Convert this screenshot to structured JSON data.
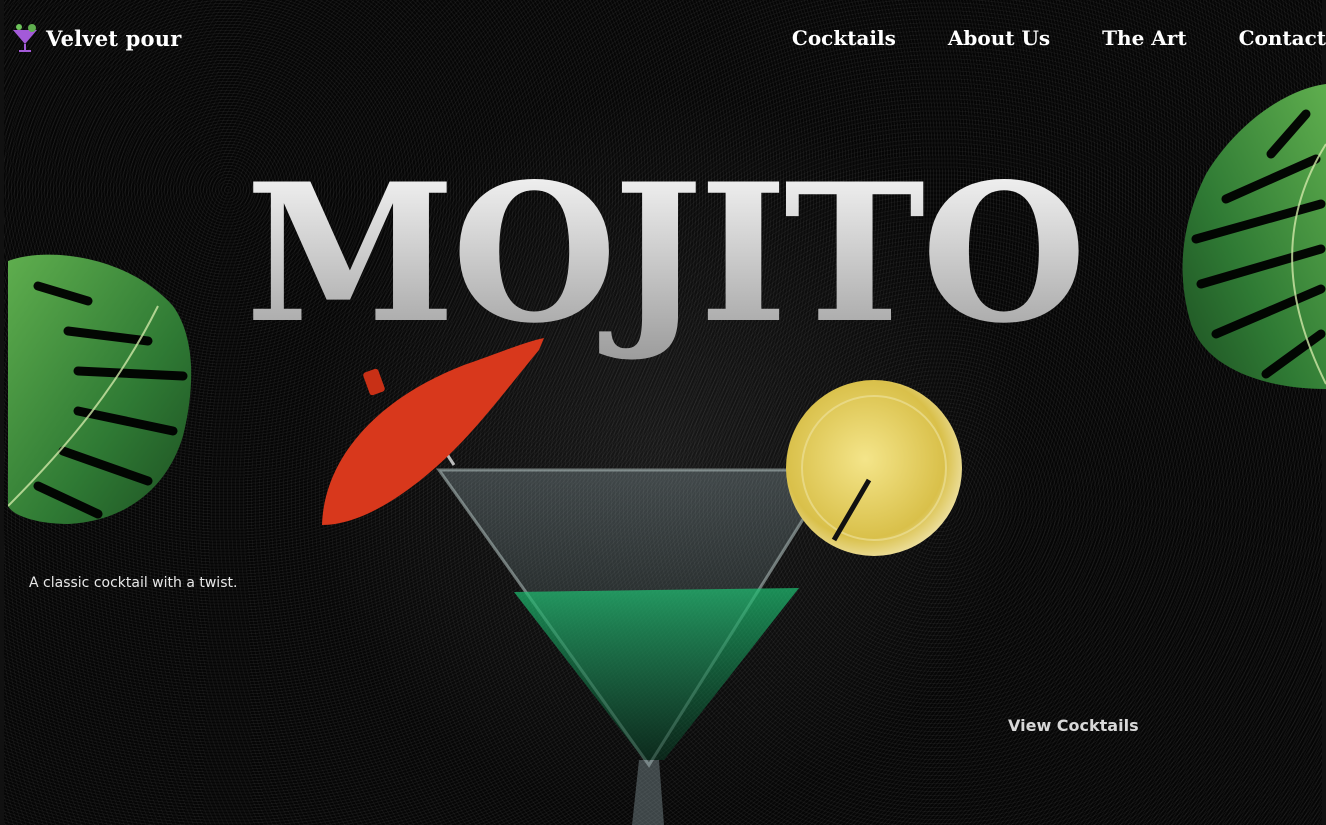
{
  "brand": {
    "name": "Velvet pour",
    "icon": "cocktail-glass-icon"
  },
  "nav": {
    "links": [
      "Cocktails",
      "About Us",
      "The Art",
      "Contact"
    ]
  },
  "hero": {
    "title": "MOJITO",
    "tagline": "A classic cocktail with a twist.",
    "cta_label": "View Cocktails"
  },
  "colors": {
    "background": "#060606",
    "title_gradient_top": "#ffffff",
    "title_gradient_bottom": "#9a9a9a",
    "leaf_green": "#2f7a34",
    "umbrella_red": "#d8381c",
    "lemon_yellow": "#e4cc5a",
    "liquid_green": "#1fbf72"
  }
}
